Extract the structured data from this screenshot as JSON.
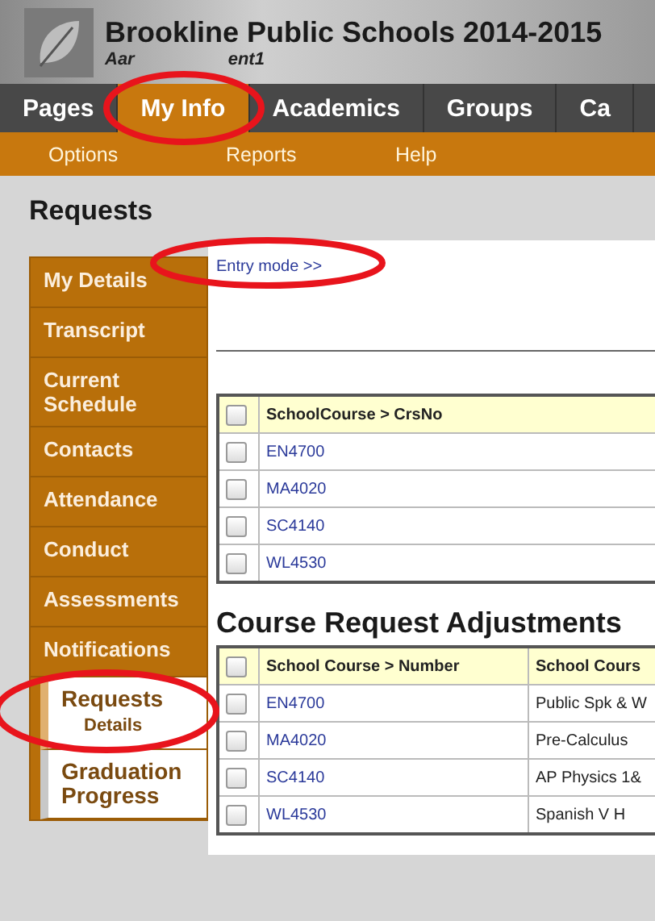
{
  "header": {
    "title": "Brookline Public Schools 2014-2015",
    "user_name_parts": [
      "Aar",
      "ent1"
    ]
  },
  "tabs": [
    {
      "label": "Pages",
      "selected": false
    },
    {
      "label": "My Info",
      "selected": true
    },
    {
      "label": "Academics",
      "selected": false
    },
    {
      "label": "Groups",
      "selected": false
    },
    {
      "label": "Ca",
      "selected": false
    }
  ],
  "subnav": [
    "Options",
    "Reports",
    "Help"
  ],
  "page_title": "Requests",
  "sidebar": {
    "items": [
      {
        "label": "My Details",
        "kind": "tab",
        "selected": false
      },
      {
        "label": "Transcript",
        "kind": "tab",
        "selected": false
      },
      {
        "label": "Current Schedule",
        "kind": "tab",
        "selected": false
      },
      {
        "label": "Contacts",
        "kind": "tab",
        "selected": false
      },
      {
        "label": "Attendance",
        "kind": "tab",
        "selected": false
      },
      {
        "label": "Conduct",
        "kind": "tab",
        "selected": false
      },
      {
        "label": "Assessments",
        "kind": "tab",
        "selected": false
      },
      {
        "label": "Notifications",
        "kind": "tab",
        "selected": false
      },
      {
        "label": "Requests",
        "kind": "tab",
        "selected": true,
        "sub": "Details"
      },
      {
        "label": "Graduation Progress",
        "kind": "link",
        "selected": false
      }
    ]
  },
  "entry_mode_link": "Entry mode >>",
  "requests_table": {
    "columns": [
      "SchoolCourse > CrsNo"
    ],
    "header_checked": false,
    "rows": [
      {
        "cells": [
          "EN4700"
        ],
        "checked": false
      },
      {
        "cells": [
          "MA4020"
        ],
        "checked": false
      },
      {
        "cells": [
          "SC4140"
        ],
        "checked": false
      },
      {
        "cells": [
          "WL4530"
        ],
        "checked": false
      }
    ]
  },
  "adjustments": {
    "title": "Course Request Adjustments",
    "columns": [
      "School Course > Number",
      "School Cours"
    ],
    "header_checked": false,
    "rows": [
      {
        "cells": [
          "EN4700",
          "Public Spk & W"
        ],
        "checked": false
      },
      {
        "cells": [
          "MA4020",
          "Pre-Calculus"
        ],
        "checked": false
      },
      {
        "cells": [
          "SC4140",
          "AP Physics 1&"
        ],
        "checked": false
      },
      {
        "cells": [
          "WL4530",
          "Spanish V H"
        ],
        "checked": false
      }
    ]
  }
}
